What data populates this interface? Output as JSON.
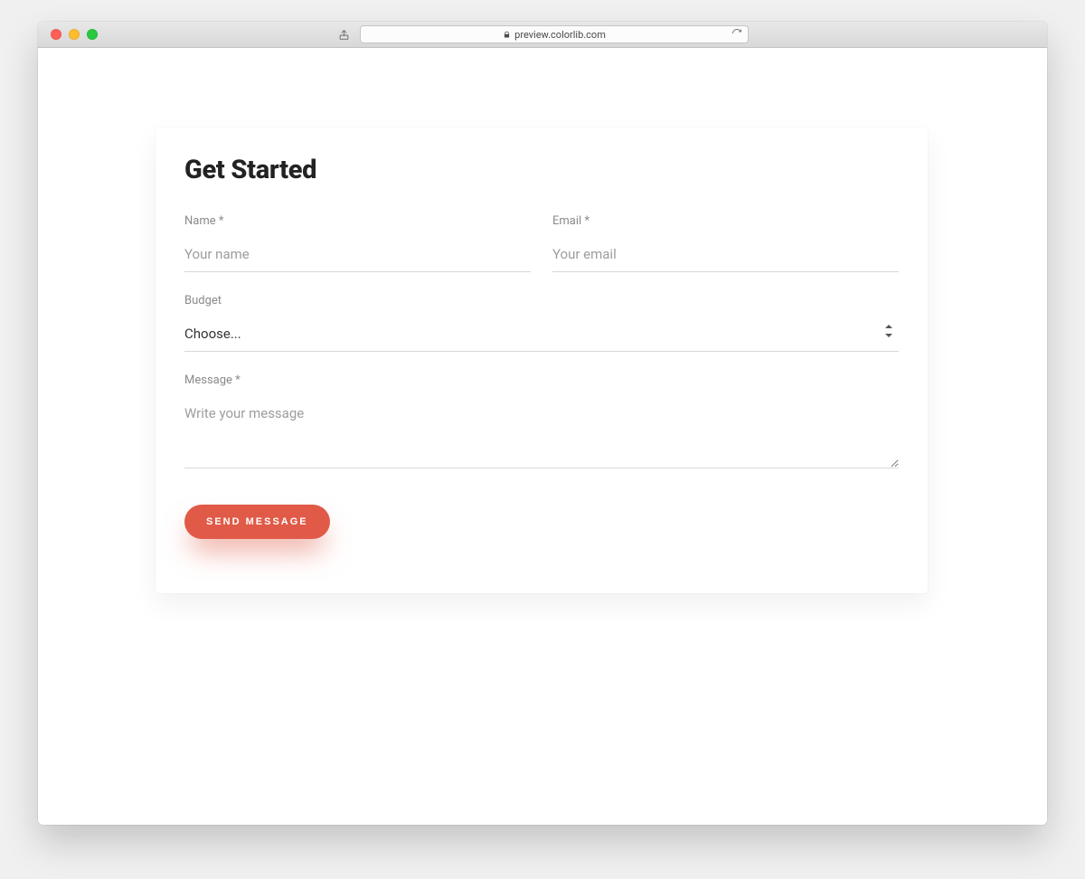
{
  "browser": {
    "url_host": "preview.colorlib.com"
  },
  "form": {
    "title": "Get Started",
    "name": {
      "label": "Name *",
      "placeholder": "Your name",
      "value": ""
    },
    "email": {
      "label": "Email *",
      "placeholder": "Your email",
      "value": ""
    },
    "budget": {
      "label": "Budget",
      "selected": "Choose..."
    },
    "message": {
      "label": "Message *",
      "placeholder": "Write your message",
      "value": ""
    },
    "submit_label": "SEND MESSAGE"
  }
}
